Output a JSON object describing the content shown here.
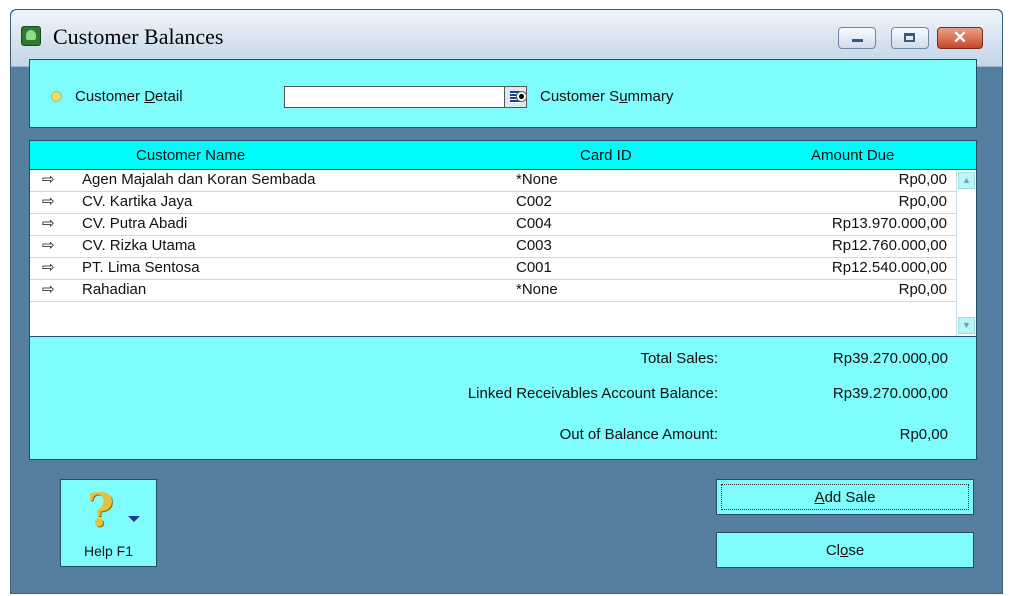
{
  "window": {
    "title": "Customer Balances"
  },
  "options": {
    "detail": {
      "before": "Customer ",
      "accel": "D",
      "after": "etail"
    },
    "combo_value": "",
    "summary": {
      "before": "Customer S",
      "accel": "u",
      "after": "mmary"
    }
  },
  "table": {
    "headers": {
      "name": "Customer Name",
      "card": "Card ID",
      "amount": "Amount Due"
    },
    "rows": [
      {
        "name": "Agen Majalah dan Koran Sembada",
        "card": "*None",
        "amount": "Rp0,00"
      },
      {
        "name": "CV. Kartika Jaya",
        "card": "C002",
        "amount": "Rp0,00"
      },
      {
        "name": "CV. Putra Abadi",
        "card": "C004",
        "amount": "Rp13.970.000,00"
      },
      {
        "name": "CV. Rizka Utama",
        "card": "C003",
        "amount": "Rp12.760.000,00"
      },
      {
        "name": "PT. Lima Sentosa",
        "card": "C001",
        "amount": "Rp12.540.000,00"
      },
      {
        "name": "Rahadian",
        "card": "*None",
        "amount": "Rp0,00"
      }
    ]
  },
  "totals": {
    "total_sales_label": "Total Sales:",
    "total_sales_value": "Rp39.270.000,00",
    "linked_label": "Linked Receivables Account Balance:",
    "linked_value": "Rp39.270.000,00",
    "out_label": "Out of Balance Amount:",
    "out_value": "Rp0,00"
  },
  "buttons": {
    "help": "Help F1",
    "add_sale": {
      "accel": "A",
      "after": "dd Sale"
    },
    "close": {
      "before": "Cl",
      "accel": "o",
      "after": "se"
    }
  },
  "colors": {
    "panel": "#7ffcfc",
    "header": "#00fbfb",
    "frame": "#547fa0"
  },
  "icons": {
    "row_marker": "right-arrow-icon",
    "help": "question-mark-icon"
  }
}
